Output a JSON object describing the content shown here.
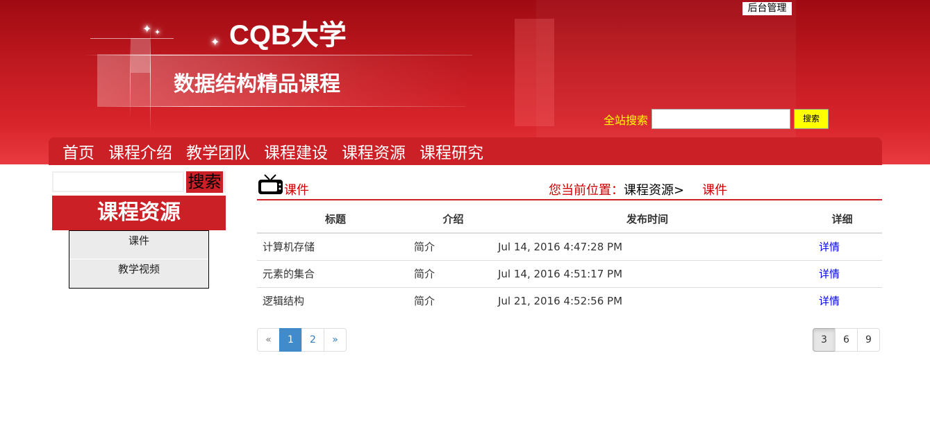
{
  "header": {
    "site_title": "CQB大学",
    "course_title": "数据结构精品课程",
    "admin_link": "后台管理",
    "search_label": "全站搜索",
    "search_value": "",
    "search_button": "搜索"
  },
  "nav": {
    "items": [
      "首页",
      "课程介绍",
      "教学团队",
      "课程建设",
      "课程资源",
      "课程研究"
    ]
  },
  "sidebar": {
    "search_value": "",
    "search_button": "搜索",
    "title": "课程资源",
    "items": [
      "课件",
      "教学视频"
    ]
  },
  "main": {
    "category": "课件",
    "breadcrumb_prefix": "您当前位置：",
    "breadcrumb_path": "课程资源>",
    "breadcrumb_current": "课件",
    "table": {
      "headers": [
        "标题",
        "介绍",
        "发布时间",
        "详细"
      ],
      "rows": [
        [
          "计算机存储",
          "简介",
          "Jul 14, 2016 4:47:28 PM",
          "详情"
        ],
        [
          "元素的集合",
          "简介",
          "Jul 14, 2016 4:51:17 PM",
          "详情"
        ],
        [
          "逻辑结构",
          "简介",
          "Jul 21, 2016 4:52:56 PM",
          "详情"
        ]
      ]
    },
    "pagination": [
      "«",
      "1",
      "2",
      "»"
    ],
    "current_page": "1",
    "page_sizes": [
      "3",
      "6",
      "9"
    ],
    "selected_page_size": "3"
  },
  "colors": {
    "brand_red": "#cc2027",
    "search_label_yellow": "#ffff00",
    "pager_active": "#428bca",
    "link_blue": "#0000ee"
  },
  "icons": [
    "tv-icon",
    "star-sparkle-icon"
  ]
}
